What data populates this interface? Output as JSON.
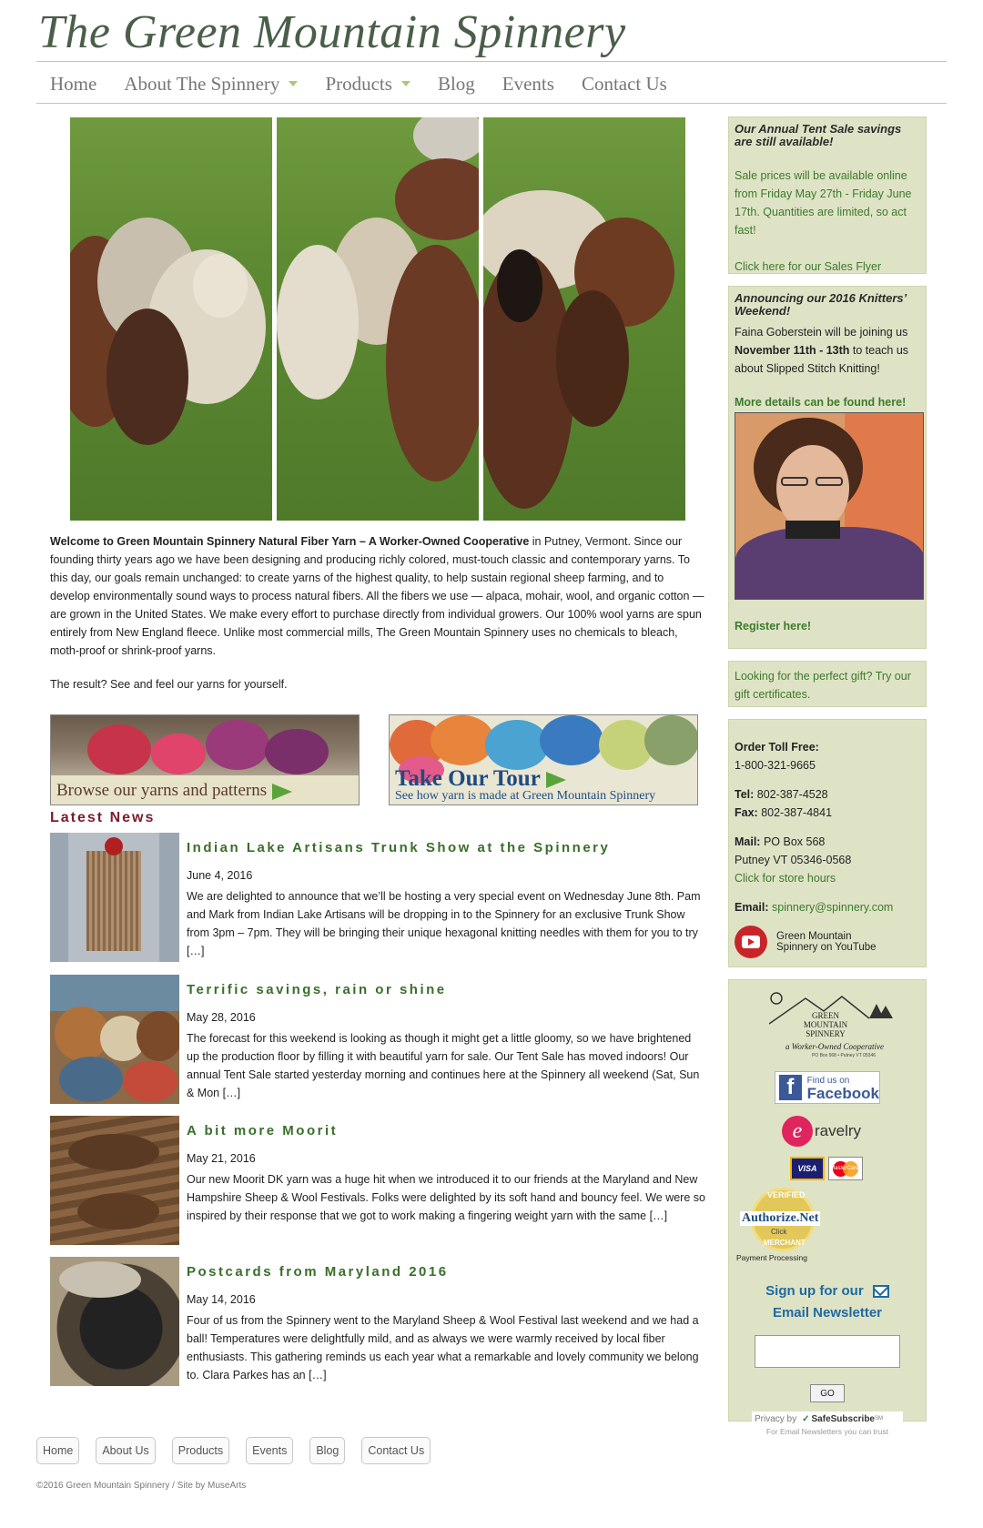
{
  "site": {
    "title": "The Green Mountain Spinnery"
  },
  "nav": {
    "items": [
      {
        "label": "Home",
        "dropdown": false
      },
      {
        "label": "About The Spinnery",
        "dropdown": true
      },
      {
        "label": "Products",
        "dropdown": true
      },
      {
        "label": "Blog",
        "dropdown": false
      },
      {
        "label": "Events",
        "dropdown": false
      },
      {
        "label": "Contact Us",
        "dropdown": false
      }
    ]
  },
  "welcome": {
    "lead": "Welcome to Green Mountain Spinnery Natural Fiber Yarn – A Worker-Owned Cooperative",
    "body": " in Putney, Vermont. Since our founding thirty years ago we have been designing and producing richly colored, must-touch classic and contemporary yarns. To this day, our goals remain unchanged: to create yarns of the highest quality, to help sustain regional sheep farming, and to develop environmentally sound ways to process natural fibers. All the fibers we use — alpaca, mohair, wool, and organic cotton — are grown in the United States. We make every effort to purchase directly from individual growers. Our 100% wool yarns are spun entirely from New England fleece. Unlike most commercial mills, The Green Mountain Spinnery uses no chemicals to bleach, moth-proof or shrink-proof yarns.",
    "result": "The result? See and feel our yarns for yourself."
  },
  "promos": {
    "browse": {
      "label": "Browse our yarns and patterns"
    },
    "tour": {
      "title": "Take Our Tour",
      "subtitle": "See how yarn is made at Green Mountain Spinnery"
    }
  },
  "news": {
    "heading": "Latest News",
    "items": [
      {
        "title": "Indian Lake Artisans Trunk Show at the Spinnery",
        "date": "June 4, 2016",
        "excerpt": "We are delighted to announce that we’ll be hosting a very special event on Wednesday June 8th.  Pam and Mark from Indian Lake Artisans will be dropping in to the Spinnery for an exclusive Trunk Show from 3pm – 7pm. They will be bringing their unique hexagonal knitting needles with them for you to try […]"
      },
      {
        "title": "Terrific savings, rain or shine",
        "date": "May 28, 2016",
        "excerpt": "The forecast for this weekend is looking as though it might get a little gloomy, so we have brightened up the production floor by filling it with beautiful yarn for sale.  Our Tent Sale has moved indoors! Our annual Tent Sale started yesterday morning and continues here at the Spinnery all weekend (Sat, Sun & Mon […]"
      },
      {
        "title": "A bit more Moorit",
        "date": "May 21, 2016",
        "excerpt": "Our new Moorit DK yarn was a huge hit when we introduced it to our friends at the Maryland and New Hampshire Sheep & Wool Festivals.  Folks were delighted by its soft hand and bouncy feel.  We were so inspired by their response that we got to work making a fingering weight yarn with the same […]"
      },
      {
        "title": "Postcards from Maryland 2016",
        "date": "May 14, 2016",
        "excerpt": "Four of us from the Spinnery went to the Maryland Sheep & Wool Festival last weekend and we had a ball!  Temperatures were delightfully mild, and as always we were warmly received by local fiber enthusiasts.  This gathering reminds us each year what a remarkable and lovely community we belong to. Clara Parkes has an […]"
      }
    ]
  },
  "sidebar": {
    "tent_sale": {
      "heading": "Our Annual Tent Sale savings are still available!",
      "body": "Sale prices will be available online from Friday May 27th - Friday June 17th. Quantities are limited, so act fast!",
      "link": "Click here for our Sales Flyer"
    },
    "knitters": {
      "heading": "Announcing our 2016 Knitters’ Weekend!",
      "body_a": "Faina Goberstein will be joining us ",
      "body_bold": "November 11th - 13th",
      "body_b": " to teach us about Slipped Stitch Knitting!",
      "details_link": "More details can be found here!",
      "register_link": "Register here!"
    },
    "gift": {
      "text": "Looking for the perfect gift? Try our gift certificates."
    },
    "contact": {
      "order_label": "Order Toll Free:",
      "order_number": "1-800-321-9665",
      "tel_label": "Tel:",
      "tel": "802-387-4528",
      "fax_label": "Fax:",
      "fax": "802-387-4841",
      "mail_label": "Mail:",
      "mail_line1": "PO Box 568",
      "mail_line2": "Putney VT 05346-0568",
      "hours_link": "Click for store hours",
      "email_label": "Email:",
      "email": "spinnery@spinnery.com",
      "youtube_line1": "Green Mountain",
      "youtube_line2": "Spinnery on YouTube"
    },
    "logos": {
      "gms_line1": "GREEN",
      "gms_line2": "MOUNTAIN",
      "gms_line3": "SPINNERY",
      "gms_tagline": "a Worker-Owned Cooperative",
      "gms_address": "PO Box 568 • Putney VT 05346",
      "facebook_small": "Find us on",
      "facebook_big": "Facebook",
      "ravelry": "ravelry",
      "visa": "VISA",
      "mastercard": "MasterCard",
      "authorize_verified": "VERIFIED",
      "authorize_name": "Authorize.Net",
      "authorize_click": "Click",
      "authorize_merchant": "MERCHANT",
      "authorize_caption": "Payment Processing"
    },
    "newsletter": {
      "heading_line1": "Sign up for our",
      "heading_line2": "Email Newsletter",
      "go": "GO",
      "privacy": "Privacy by",
      "safe": "SafeSubscribe",
      "sm": "SM",
      "trust": "For Email Newsletters you can trust"
    }
  },
  "footer": {
    "nav": [
      "Home",
      "About Us",
      "Products",
      "Events",
      "Blog",
      "Contact Us"
    ],
    "copyright": "©2016 Green Mountain Spinnery / Site by MuseArts"
  },
  "colors": {
    "title": "#4a5e4a",
    "news_title": "#3a6e2a",
    "news_heading": "#7a1c2c",
    "sidebar_bg": "#dfe3c6",
    "link_green": "#3c7a2a",
    "tour_blue": "#1f4c80"
  }
}
